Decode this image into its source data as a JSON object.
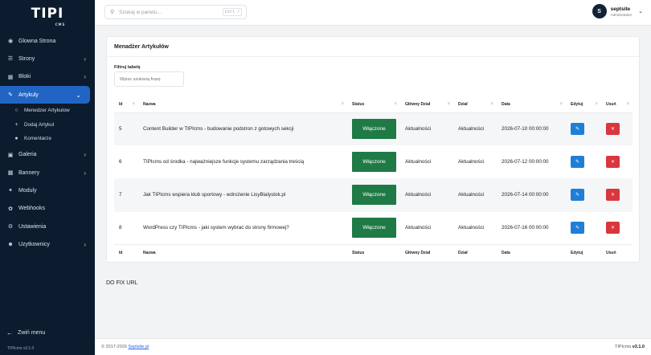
{
  "sidebar": {
    "logo": "TIPI",
    "logo_sub": "CMS",
    "items": [
      {
        "label": "Glowna Strona",
        "icon": "palette-icon",
        "chevron": false
      },
      {
        "label": "Strony",
        "icon": "list-icon",
        "chevron": true
      },
      {
        "label": "Bloki",
        "icon": "blocks-icon",
        "chevron": true
      },
      {
        "label": "Artykuly",
        "icon": "edit-icon",
        "chevron": true,
        "active": true
      }
    ],
    "subitems": [
      {
        "label": "Menedzer Artykulow",
        "icon": "circle-icon"
      },
      {
        "label": "Dodaj Artykul",
        "icon": "plus-icon"
      },
      {
        "label": "Komentarze",
        "icon": "comments-icon"
      }
    ],
    "items2": [
      {
        "label": "Galeria",
        "icon": "gallery-icon",
        "chevron": true
      },
      {
        "label": "Bannery",
        "icon": "banner-icon",
        "chevron": true
      },
      {
        "label": "Moduly",
        "icon": "puzzle-icon",
        "chevron": false
      },
      {
        "label": "Webhooks",
        "icon": "webhook-icon",
        "chevron": false
      },
      {
        "label": "Ustawienia",
        "icon": "gear-icon",
        "chevron": false
      },
      {
        "label": "Uzytkownicy",
        "icon": "users-icon",
        "chevron": true
      }
    ],
    "collapse_label": "Zwiń menu",
    "version": "TIPIcms v3.1.0"
  },
  "topbar": {
    "search_placeholder": "Szukaj w panelu...",
    "shortcut": "Ctrl /",
    "user_initial": "S",
    "user_name": "septsite",
    "user_role": "Administrator"
  },
  "card": {
    "title": "Menadżer Artykułów",
    "filter_label": "Filtruj tabelę",
    "filter_placeholder": "Wpisz szukaną frazę",
    "columns": [
      "Id",
      "Nazwa",
      "Status",
      "Główny Dział",
      "Dział",
      "Data",
      "Edytuj",
      "Usuń"
    ],
    "rows": [
      {
        "id": "5",
        "name": "Content Builder w TIPIcms - budowanie podstron z gotowych sekcji",
        "status": "Włączone",
        "main_section": "Aktualności",
        "section": "Aktualności",
        "date": "2026-07-10 00:00:00"
      },
      {
        "id": "6",
        "name": "TIPIcms od środka - najważniejsze funkcje systemu zarządzania treścią",
        "status": "Włączone",
        "main_section": "Aktualności",
        "section": "Aktualności",
        "date": "2026-07-12 00:00:00"
      },
      {
        "id": "7",
        "name": "Jak TIPIcms wspiera klub sportowy - wdrożenie LisyBialystok.pl",
        "status": "Włączone",
        "main_section": "Aktualności",
        "section": "Aktualności",
        "date": "2026-07-14 00:00:00"
      },
      {
        "id": "8",
        "name": "WordPress czy TIPIcms - jaki system wybrać do strony firmowej?",
        "status": "Włączone",
        "main_section": "Aktualności",
        "section": "Aktualności",
        "date": "2026-07-16 00:00:00"
      }
    ]
  },
  "fix_url": "DO FIX URL",
  "footer": {
    "copy_prefix": "© 2017-2026 ",
    "copy_link": "Septsite.pl",
    "version_prefix": "TIPIcms ",
    "version": "v3.1.0"
  },
  "colors": {
    "sidebar_bg": "#0d1b2e",
    "active_nav": "#2264c4",
    "status_green": "#1f7a45",
    "edit_blue": "#1f7fd6",
    "delete_red": "#d9363e"
  }
}
